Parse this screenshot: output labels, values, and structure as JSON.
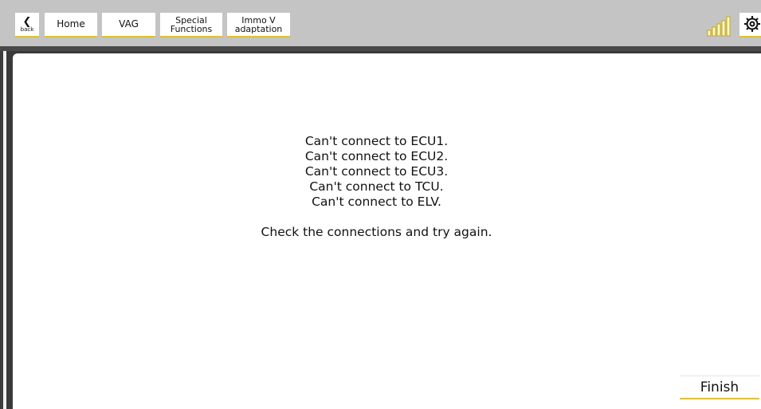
{
  "nav": {
    "back_label": "back",
    "items": [
      {
        "label": "Home"
      },
      {
        "label": "VAG"
      },
      {
        "label_line1": "Special",
        "label_line2": "Functions"
      },
      {
        "label_line1": "Immo V",
        "label_line2": "adaptation"
      }
    ]
  },
  "status": {
    "signal_icon": "signal-strength-icon",
    "settings_icon": "gear-icon",
    "accent_color": "#e8c400"
  },
  "message": {
    "lines": [
      "Can't connect to ECU1.",
      "Can't connect to ECU2.",
      "Can't connect to ECU3.",
      "Can't connect to TCU.",
      "Can't connect to ELV."
    ],
    "hint": "Check the connections and try again."
  },
  "actions": {
    "finish_label": "Finish"
  }
}
